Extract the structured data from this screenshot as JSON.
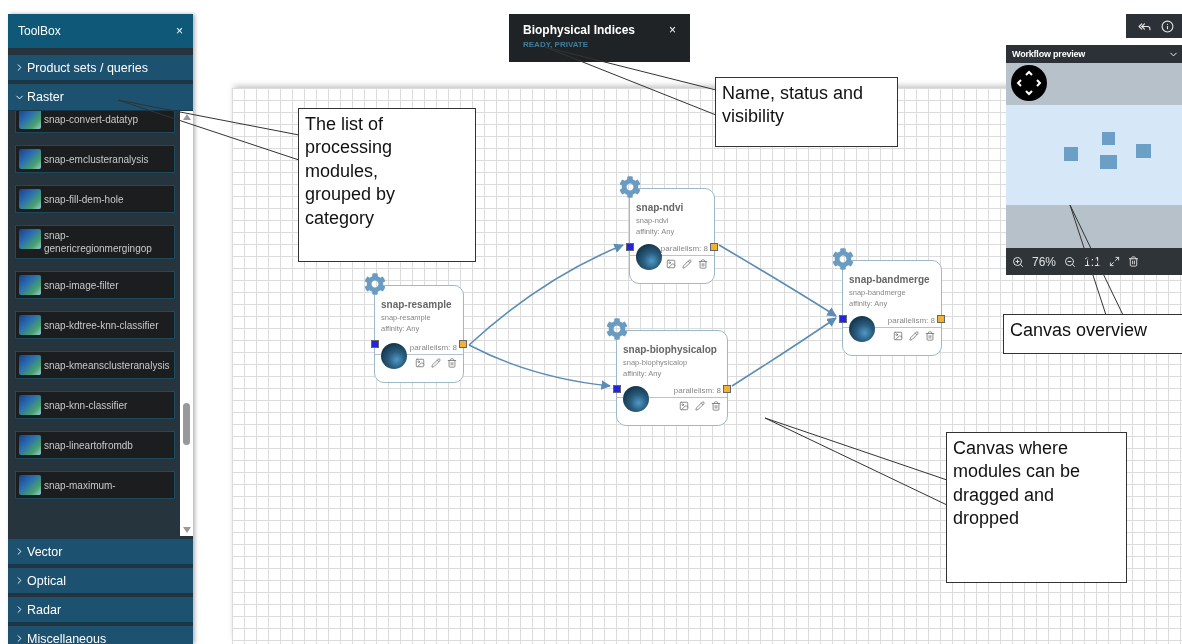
{
  "toolbox": {
    "title": "ToolBox",
    "close": "×",
    "categories": [
      {
        "label": "Product sets / queries",
        "expanded": false
      },
      {
        "label": "Raster",
        "expanded": true,
        "items": [
          "snap-convert-datatyp",
          "snap-emclusteranalysis",
          "snap-fill-dem-hole",
          "snap-genericregionmergingop",
          "snap-image-filter",
          "snap-kdtree-knn-classifier",
          "snap-kmeansclusteranalysis",
          "snap-knn-classifier",
          "snap-lineartofromdb",
          "snap-maximum-"
        ]
      },
      {
        "label": "Vector",
        "expanded": false
      },
      {
        "label": "Optical",
        "expanded": false
      },
      {
        "label": "Radar",
        "expanded": false
      },
      {
        "label": "Miscellaneous",
        "expanded": false
      }
    ]
  },
  "workflow": {
    "name": "Biophysical Indices",
    "status": "READY, PRIVATE",
    "close": "×"
  },
  "nodes": [
    {
      "title": "snap-resample",
      "subtitle": "snap-resample",
      "affinity": "affinity: Any",
      "parallelism": "parallelism: 8"
    },
    {
      "title": "snap-ndvi",
      "subtitle": "snap-ndvi",
      "affinity": "affinity: Any",
      "parallelism": "parallelism: 8"
    },
    {
      "title": "snap-biophysicalop",
      "subtitle": "snap-biophysicalop",
      "affinity": "affinity: Any",
      "parallelism": "parallelism: 8"
    },
    {
      "title": "snap-bandmerge",
      "subtitle": "snap-bandmerge",
      "affinity": "affinity: Any",
      "parallelism": "parallelism: 8"
    }
  ],
  "preview": {
    "title": "Workflow preview",
    "zoom": "76%",
    "ratio": "1:1"
  },
  "callouts": [
    "The list of processing modules, grouped by category",
    "Name, status and visibility",
    "Canvas overview",
    "Canvas where modules can be dragged and dropped"
  ]
}
